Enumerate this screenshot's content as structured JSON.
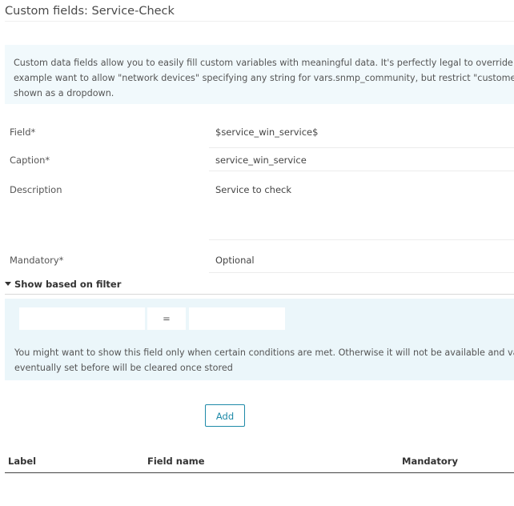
{
  "page": {
    "title": "Custom fields: Service-Check"
  },
  "info": {
    "line1": "Custom data fields allow you to easily fill custom variables with meaningful data. It's perfectly legal to override inherited",
    "line2": "example want to allow \"network devices\" specifying any string for vars.snmp_community, but restrict \"customer routers\"",
    "line3": "shown as a dropdown."
  },
  "form": {
    "field": {
      "label": "Field*",
      "value": "$service_win_service$"
    },
    "caption": {
      "label": "Caption*",
      "value": "service_win_service"
    },
    "description": {
      "label": "Description",
      "value": "Service to check"
    },
    "mandatory": {
      "label": "Mandatory*",
      "value": "Optional"
    }
  },
  "filter_section": {
    "title": "Show based on filter",
    "operator": "=",
    "left_value": "",
    "right_value": "",
    "hint_line1": "You might want to show this field only when certain conditions are met. Otherwise it will not be available and values",
    "hint_line2": "eventually set before will be cleared once stored"
  },
  "add_button": "Add",
  "table": {
    "columns": [
      "Label",
      "Field name",
      "Mandatory"
    ]
  },
  "colors": {
    "accent": "#1e8aa8",
    "info_bg": "#f1f9fc",
    "filter_bg": "#ebf6fa"
  }
}
